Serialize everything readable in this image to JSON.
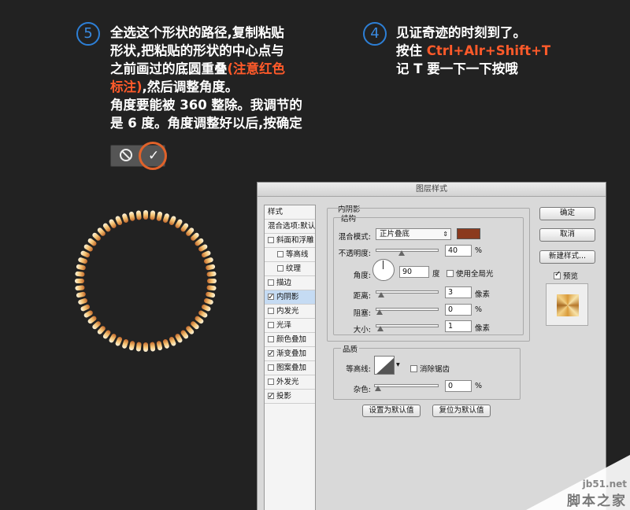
{
  "step5": {
    "number": "5",
    "line1": "全选这个形状的路径,复制粘贴",
    "line2": "形状,把粘贴的形状的中心点与",
    "line3a": "之前画过的底圆重叠",
    "line3b": "(注意红色",
    "line4a": "标注)",
    "line4b": ",然后调整角度。",
    "line5": "角度要能被 360 整除。我调节的",
    "line6": "是 6 度。角度调整好以后,按确定"
  },
  "step4": {
    "number": "4",
    "line1": "见证奇迹的时刻到了。",
    "line2a": "按住 ",
    "line2b": "Ctrl+Alr+Shift+T",
    "line3": "记 T 要一下一下按哦"
  },
  "ring": {
    "dash_count": 60,
    "angle_step_deg": 6,
    "colors": [
      "#c0652a",
      "#e89a3c",
      "#f5d8a0",
      "#fff6df"
    ]
  },
  "dialog": {
    "title": "图层样式",
    "style_list": {
      "header": "样式",
      "items": [
        {
          "label": "混合选项:默认",
          "checkbox": false,
          "checked": false,
          "indent": false,
          "active": false
        },
        {
          "label": "斜面和浮雕",
          "checkbox": true,
          "checked": false,
          "indent": false,
          "active": false
        },
        {
          "label": "等高线",
          "checkbox": true,
          "checked": false,
          "indent": true,
          "active": false
        },
        {
          "label": "纹理",
          "checkbox": true,
          "checked": false,
          "indent": true,
          "active": false
        },
        {
          "label": "描边",
          "checkbox": true,
          "checked": false,
          "indent": false,
          "active": false
        },
        {
          "label": "内阴影",
          "checkbox": true,
          "checked": true,
          "indent": false,
          "active": true
        },
        {
          "label": "内发光",
          "checkbox": true,
          "checked": false,
          "indent": false,
          "active": false
        },
        {
          "label": "光泽",
          "checkbox": true,
          "checked": false,
          "indent": false,
          "active": false
        },
        {
          "label": "颜色叠加",
          "checkbox": true,
          "checked": false,
          "indent": false,
          "active": false
        },
        {
          "label": "渐变叠加",
          "checkbox": true,
          "checked": true,
          "indent": false,
          "active": false
        },
        {
          "label": "图案叠加",
          "checkbox": true,
          "checked": false,
          "indent": false,
          "active": false
        },
        {
          "label": "外发光",
          "checkbox": true,
          "checked": false,
          "indent": false,
          "active": false
        },
        {
          "label": "投影",
          "checkbox": true,
          "checked": true,
          "indent": false,
          "active": false
        }
      ]
    },
    "inner_shadow": {
      "section_title": "内阴影",
      "structure_title": "结构",
      "blend_mode_label": "混合模式:",
      "blend_mode_value": "正片叠底",
      "blend_color": "#8b3a1e",
      "opacity_label": "不透明度:",
      "opacity_value": "40",
      "opacity_fraction": 0.4,
      "opacity_unit": "%",
      "angle_label": "角度:",
      "angle_value": "90",
      "angle_deg": 90,
      "angle_unit": "度",
      "global_light_label": "使用全局光",
      "distance_label": "距离:",
      "distance_value": "3",
      "distance_fraction": 0.03,
      "distance_unit": "像素",
      "choke_label": "阻塞:",
      "choke_value": "0",
      "choke_fraction": 0,
      "choke_unit": "%",
      "size_label": "大小:",
      "size_value": "1",
      "size_fraction": 0.01,
      "size_unit": "像素",
      "quality_title": "品质",
      "contour_label": "等高线:",
      "antialias_label": "消除锯齿",
      "noise_label": "杂色:",
      "noise_value": "0",
      "noise_fraction": 0,
      "noise_unit": "%",
      "make_default_label": "设置为默认值",
      "reset_default_label": "复位为默认值"
    },
    "buttons": {
      "ok": "确定",
      "cancel": "取消",
      "new_style": "新建样式...",
      "preview_label": "预览"
    }
  },
  "watermark": {
    "site": "jb51.net",
    "name": "脚本之家"
  }
}
